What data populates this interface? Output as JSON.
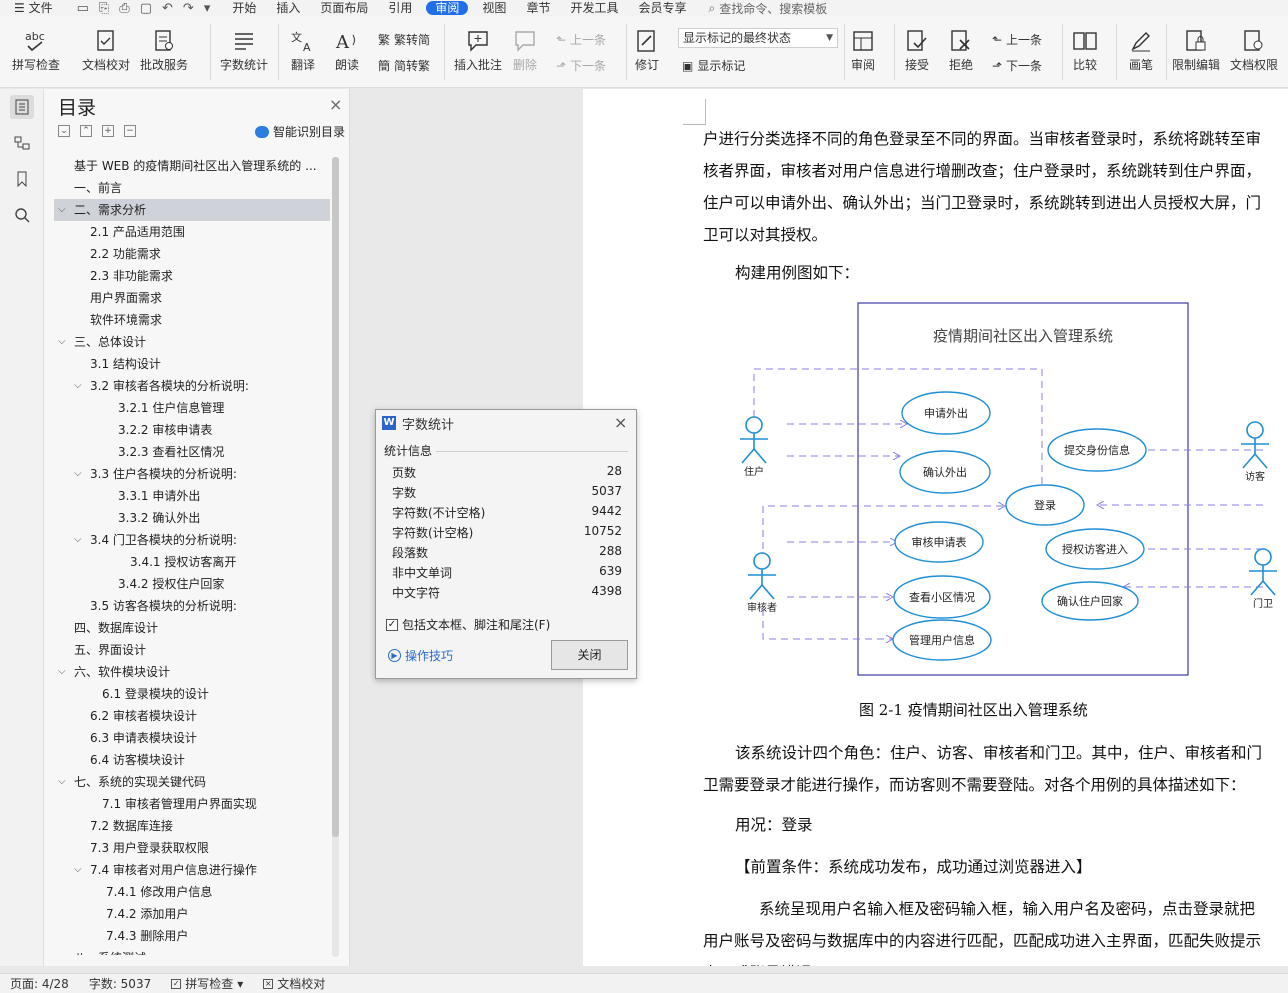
{
  "menubar": {
    "file": "文件",
    "tabs": [
      "开始",
      "插入",
      "页面布局",
      "引用",
      "审阅",
      "视图",
      "章节",
      "开发工具",
      "会员专享"
    ],
    "active_tab": "审阅",
    "search_placeholder": "查找命令、搜索模板"
  },
  "ribbon": {
    "spell_check": "拼写检查",
    "doc_proof": "文档校对",
    "batch_service": "批改服务",
    "word_count": "字数统计",
    "translate": "翻译",
    "read_aloud": "朗读",
    "trad_to_simp": "繁转简",
    "simp_to_trad": "简转繁",
    "insert_comment": "插入批注",
    "delete": "删除",
    "prev": "上一条",
    "next": "下一条",
    "track": "修订",
    "display_mode": "显示标记的最终状态",
    "show_markup": "显示标记",
    "review": "审阅",
    "accept": "接受",
    "reject": "拒绝",
    "prev2": "上一条",
    "next2": "下一条",
    "compare": "比较",
    "pen": "画笔",
    "restrict_edit": "限制编辑",
    "doc_permission": "文档权限"
  },
  "toc": {
    "title": "目录",
    "smart_label": "智能识别目录",
    "items": [
      {
        "text": "基于 WEB 的疫情期间社区出入管理系统的 ...",
        "level": 0,
        "tw": ""
      },
      {
        "text": "一、前言",
        "level": 0,
        "tw": ""
      },
      {
        "text": "二、需求分析",
        "level": 0,
        "tw": "open",
        "sel": true
      },
      {
        "text": "2.1 产品适用范围",
        "level": 1,
        "tw": ""
      },
      {
        "text": "2.2 功能需求",
        "level": 1,
        "tw": ""
      },
      {
        "text": "2.3 非功能需求",
        "level": 1,
        "tw": ""
      },
      {
        "text": "用户界面需求",
        "level": 1,
        "tw": ""
      },
      {
        "text": "软件环境需求",
        "level": 1,
        "tw": ""
      },
      {
        "text": "三、总体设计",
        "level": 0,
        "tw": "open"
      },
      {
        "text": "3.1 结构设计",
        "level": 1,
        "tw": ""
      },
      {
        "text": "3.2 审核者各模块的分析说明:",
        "level": 1,
        "tw": "open"
      },
      {
        "text": "3.2.1 住户信息管理",
        "level": 2,
        "tw": ""
      },
      {
        "text": "3.2.2  审核申请表",
        "level": 2,
        "tw": ""
      },
      {
        "text": "3.2.3  查看社区情况",
        "level": 2,
        "tw": ""
      },
      {
        "text": "3.3 住户各模块的分析说明:",
        "level": 1,
        "tw": "open"
      },
      {
        "text": "3.3.1 申请外出",
        "level": 2,
        "tw": ""
      },
      {
        "text": "3.3.2  确认外出",
        "level": 2,
        "tw": ""
      },
      {
        "text": "3.4 门卫各模块的分析说明:",
        "level": 1,
        "tw": "open"
      },
      {
        "text": "3.4.1  授权访客离开",
        "level": 3,
        "tw": ""
      },
      {
        "text": "3.4.2  授权住户回家",
        "level": 2,
        "tw": ""
      },
      {
        "text": "3.5 访客各模块的分析说明:",
        "level": 1,
        "tw": ""
      },
      {
        "text": "四、数据库设计",
        "level": 0,
        "tw": ""
      },
      {
        "text": "五、界面设计",
        "level": 0,
        "tw": ""
      },
      {
        "text": "六、软件模块设计",
        "level": 0,
        "tw": "open"
      },
      {
        "text": "6.1 登录模块的设计",
        "level": 4,
        "tw": ""
      },
      {
        "text": "6.2 审核者模块设计",
        "level": 1,
        "tw": ""
      },
      {
        "text": "6.3 申请表模块设计",
        "level": 1,
        "tw": ""
      },
      {
        "text": "6.4 访客模块设计",
        "level": 1,
        "tw": ""
      },
      {
        "text": "七、系统的实现关键代码",
        "level": 0,
        "tw": "open"
      },
      {
        "text": "7.1 审核者管理用户界面实现",
        "level": 4,
        "tw": ""
      },
      {
        "text": "7.2  数据库连接",
        "level": 1,
        "tw": ""
      },
      {
        "text": "7.3 用户登录获取权限",
        "level": 1,
        "tw": ""
      },
      {
        "text": "7.4 审核者对用户信息进行操作",
        "level": 1,
        "tw": "open"
      },
      {
        "text": "7.4.1  修改用户信息",
        "level": 5,
        "tw": ""
      },
      {
        "text": "7.4.2  添加用户",
        "level": 5,
        "tw": ""
      },
      {
        "text": "7.4.3  删除用户",
        "level": 5,
        "tw": ""
      },
      {
        "text": "八、系统测试",
        "level": 0,
        "tw": "open"
      }
    ]
  },
  "dialog": {
    "title": "字数统计",
    "section": "统计信息",
    "stats": [
      {
        "label": "页数",
        "value": "28"
      },
      {
        "label": "字数",
        "value": "5037"
      },
      {
        "label": "字符数(不计空格)",
        "value": "9442"
      },
      {
        "label": "字符数(计空格)",
        "value": "10752"
      },
      {
        "label": "段落数",
        "value": "288"
      },
      {
        "label": "非中文单词",
        "value": "639"
      },
      {
        "label": "中文字符",
        "value": "4398"
      }
    ],
    "checkbox_label": "包括文本框、脚注和尾注(F)",
    "tips_label": "操作技巧",
    "close_label": "关闭"
  },
  "doc": {
    "para1": "户进行分类选择不同的角色登录至不同的界面。当审核者登录时，系统将跳转至审核者界面，审核者对用户信息进行增删改查；住户登录时，系统跳转到住户界面，住户可以申请外出、确认外出；当门卫登录时，系统跳转到进出人员授权大屏，门卫可以对其授权。",
    "para2": "构建用例图如下：",
    "diagram": {
      "system_title": "疫情期间社区出入管理系统",
      "actors": [
        "住户",
        "访客",
        "审核者",
        "门卫"
      ],
      "usecases": [
        "申请外出",
        "确认外出",
        "提交身份信息",
        "登录",
        "审核申请表",
        "授权访客进入",
        "查看小区情况",
        "确认住户回家",
        "管理用户信息"
      ]
    },
    "caption": "图 2-1  疫情期间社区出入管理系统",
    "para3": "该系统设计四个角色：住户、访客、审核者和门卫。其中，住户、审核者和门卫需要登录才能进行操作，而访客则不需要登陆。对各个用例的具体描述如下：",
    "para4": "用况：登录",
    "para5": "【前置条件：系统成功发布，成功通过浏览器进入】",
    "para6": "系统呈现用户名输入框及密码输入框，输入用户名及密码，点击登录就把用户账号及密码与数据库中的内容进行匹配，匹配成功进入主界面，匹配失败提示密码或账号错误。"
  },
  "status": {
    "page": "页面: 4/28",
    "words": "字数: 5037",
    "spell": "拼写检查",
    "proof": "文档校对"
  }
}
